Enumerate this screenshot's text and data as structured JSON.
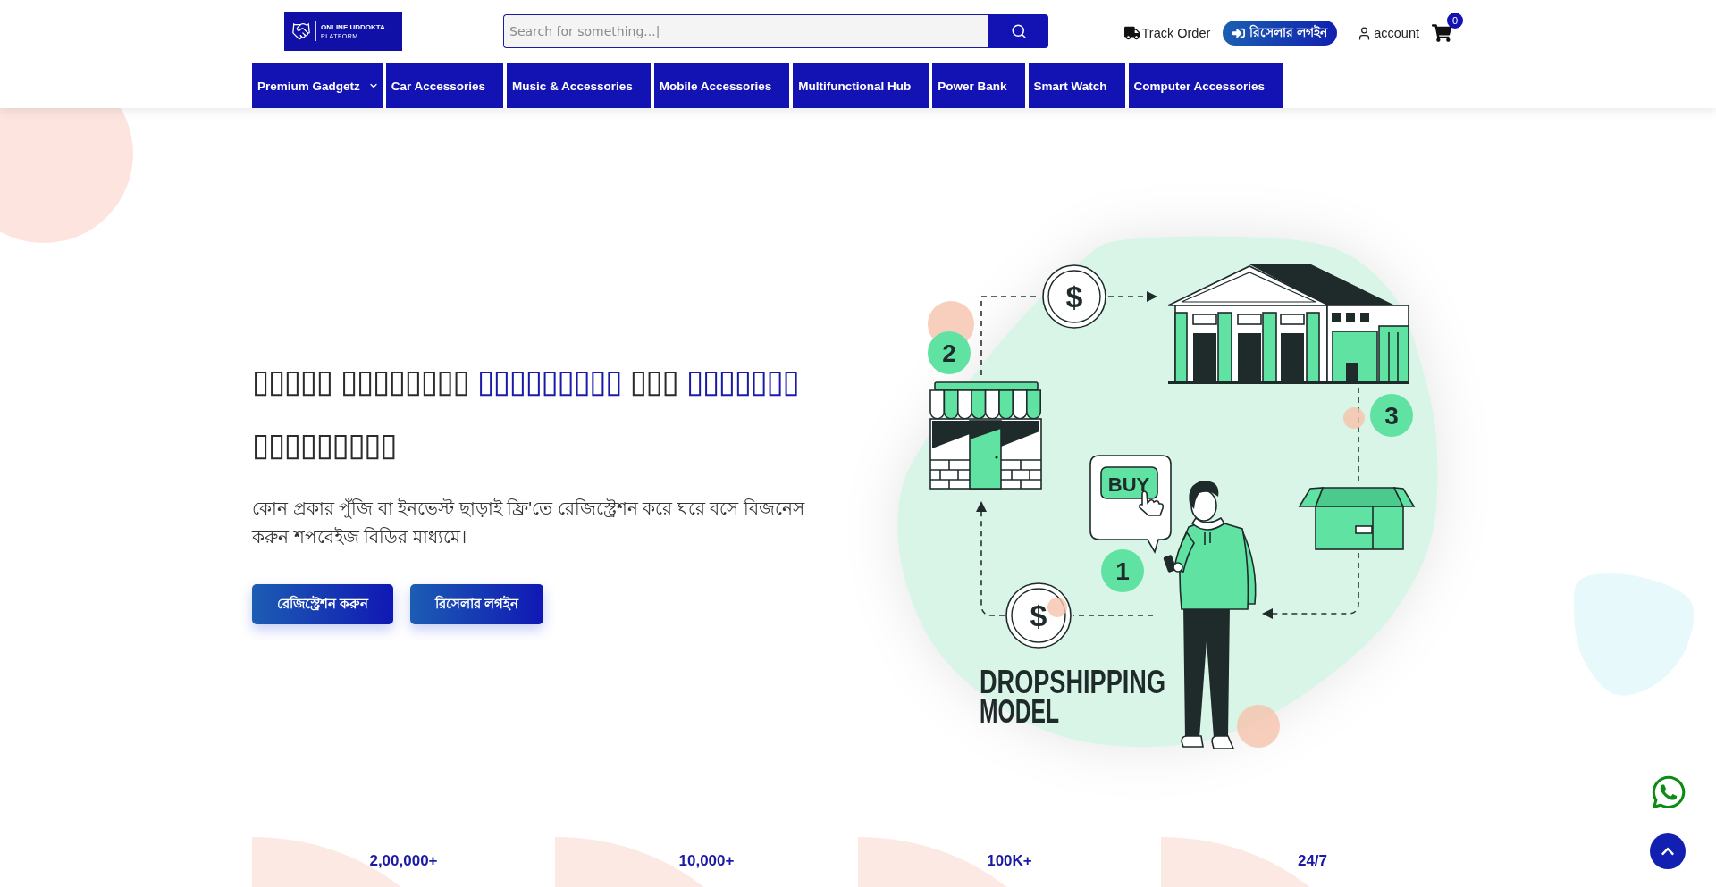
{
  "header": {
    "logo": {
      "title": "ONLINE UDDOKTA",
      "subtitle": "PLATFORM"
    },
    "search": {
      "placeholder": "Search for something...|"
    },
    "actions": [
      {
        "kind": "track",
        "label": "Track Order"
      },
      {
        "kind": "login",
        "label": "রিসেলার লগইন"
      },
      {
        "kind": "account",
        "label": "account"
      }
    ],
    "cart": {
      "count": "0"
    }
  },
  "nav": [
    {
      "label": "Premium Gadgetz",
      "has_submenu": true
    },
    {
      "label": "Car Accessories",
      "has_submenu": false
    },
    {
      "label": "Music & Accessories",
      "has_submenu": false
    },
    {
      "label": "Mobile Accessories",
      "has_submenu": false
    },
    {
      "label": "Multifunctional Hub",
      "has_submenu": false
    },
    {
      "label": "Power Bank",
      "has_submenu": false
    },
    {
      "label": "Smart Watch",
      "has_submenu": false
    },
    {
      "label": "Computer Accessories",
      "has_submenu": false
    }
  ],
  "hero": {
    "title_lines": [
      [
        {
          "text": "▯▯▯▯▯ ▯▯▯▯▯▯▯▯ ",
          "accent": false
        },
        {
          "text": "▯▯▯▯▯▯▯▯▯",
          "accent": true
        },
        {
          "text": " ▯▯▯ ",
          "accent": false
        },
        {
          "text": "▯▯▯▯▯▯▯",
          "accent": true
        }
      ],
      [
        {
          "text": "▯▯▯▯▯▯▯▯▯",
          "accent": false
        }
      ]
    ],
    "description": "কোন প্রকার পুঁজি বা ইনভেস্ট ছাড়াই ফ্রি'তে রেজিস্ট্রেশন করে ঘরে বসে বিজনেস করুন শপবেইজ বিডির মাধ্যমে।",
    "buttons": [
      {
        "label": "রেজিস্ট্রেশন করুন"
      },
      {
        "label": "রিসেলার লগইন"
      }
    ]
  },
  "illustration": {
    "coins": [
      "$",
      "$"
    ],
    "steps": [
      "1",
      "2",
      "3"
    ],
    "buy_label": "BUY",
    "caption_lines": [
      "DROPSHIPPING",
      "MODEL"
    ]
  },
  "stats": [
    {
      "value": "2,00,000+"
    },
    {
      "value": "10,000+"
    },
    {
      "value": "100K+"
    },
    {
      "value": "24/7"
    }
  ]
}
